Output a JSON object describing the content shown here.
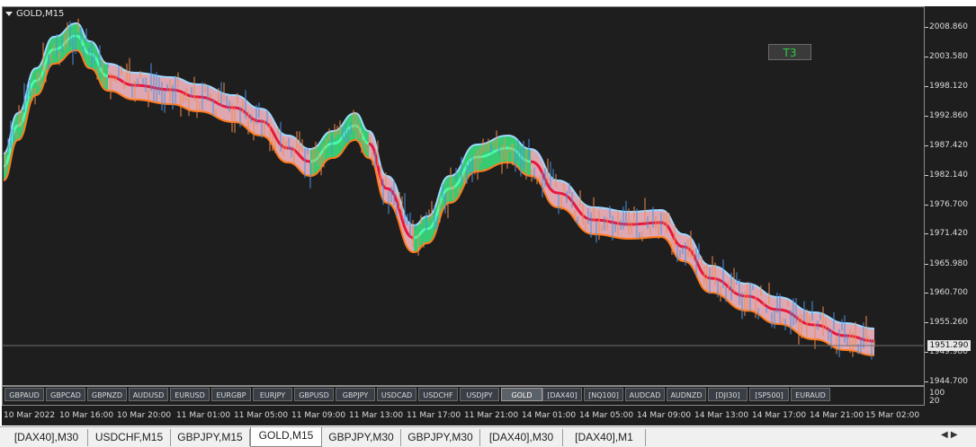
{
  "chart": {
    "title": "GOLD,M15",
    "badge": "T3",
    "current_price": "1951.290",
    "price_labels": [
      "2008.860",
      "2003.580",
      "1998.120",
      "1992.860",
      "1987.420",
      "1982.140",
      "1976.700",
      "1971.420",
      "1965.980",
      "1960.700",
      "1955.260",
      "1949.980",
      "1944.700"
    ],
    "indicator_labels": [
      "100",
      "20"
    ],
    "time_labels": [
      "10 Mar 2022",
      "10 Mar 16:00",
      "10 Mar 20:00",
      "11 Mar 01:00",
      "11 Mar 05:00",
      "11 Mar 09:00",
      "11 Mar 13:00",
      "11 Mar 17:00",
      "11 Mar 21:00",
      "14 Mar 01:00",
      "14 Mar 05:00",
      "14 Mar 09:00",
      "14 Mar 13:00",
      "14 Mar 17:00",
      "14 Mar 21:00",
      "15 Mar 02:00"
    ],
    "colors": {
      "background": "#1e1e1e",
      "bull_candle": "#4a90e2",
      "bear_candle": "#f08a4b",
      "band_up": "#2ecc71",
      "band_down": "#f4b6c2",
      "mid_down": "#e8183c",
      "mid_up": "#44ffaa"
    }
  },
  "symbols": [
    "GBPAUD",
    "GBPCAD",
    "GBPNZD",
    "AUDUSD",
    "EURUSD",
    "EURGBP",
    "EURJPY",
    "GBPUSD",
    "GBPJPY",
    "USDCAD",
    "USDCHF",
    "USDJPY",
    "GOLD",
    "[DAX40]",
    "[NQ100]",
    "AUDCAD",
    "AUDNZD",
    "[DJI30]",
    "[SP500]",
    "EURAUD"
  ],
  "active_symbol": "GOLD",
  "tabs": [
    "[DAX40],M30",
    "USDCHF,M15",
    "GBPJPY,M15",
    "GOLD,M15",
    "GBPJPY,M30",
    "GBPJPY,M30",
    "[DAX40],M30",
    "[DAX40],M1"
  ],
  "active_tab": "GOLD,M15"
}
